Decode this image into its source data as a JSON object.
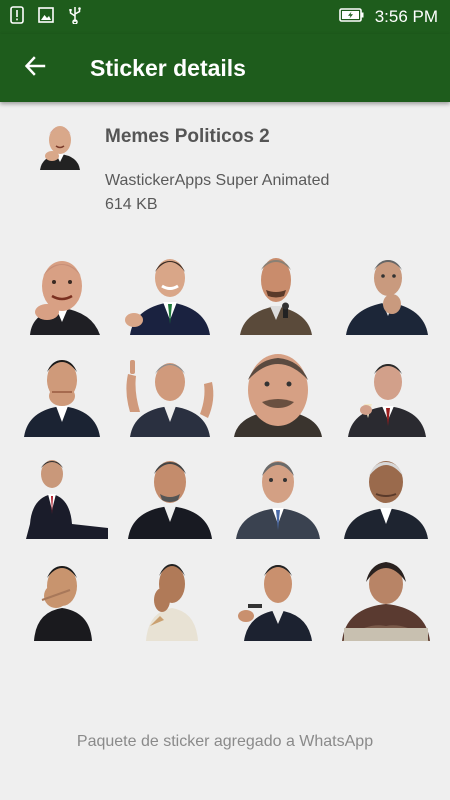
{
  "status_bar": {
    "time": "3:56 PM",
    "icons": [
      "alert-icon",
      "image-icon",
      "usb-icon",
      "battery-charging-icon"
    ]
  },
  "app_bar": {
    "title": "Sticker details",
    "back_icon": "back-arrow-icon"
  },
  "pack": {
    "name": "Memes Politicos 2",
    "publisher": "WastickerApps Super Animated",
    "size": "614 KB"
  },
  "stickers": {
    "count": 16,
    "rows": 4,
    "columns": 4
  },
  "footer": {
    "message": "Paquete de sticker agregado a WhatsApp"
  },
  "colors": {
    "app_bar": "#1e5c1c",
    "background": "#efefef"
  }
}
